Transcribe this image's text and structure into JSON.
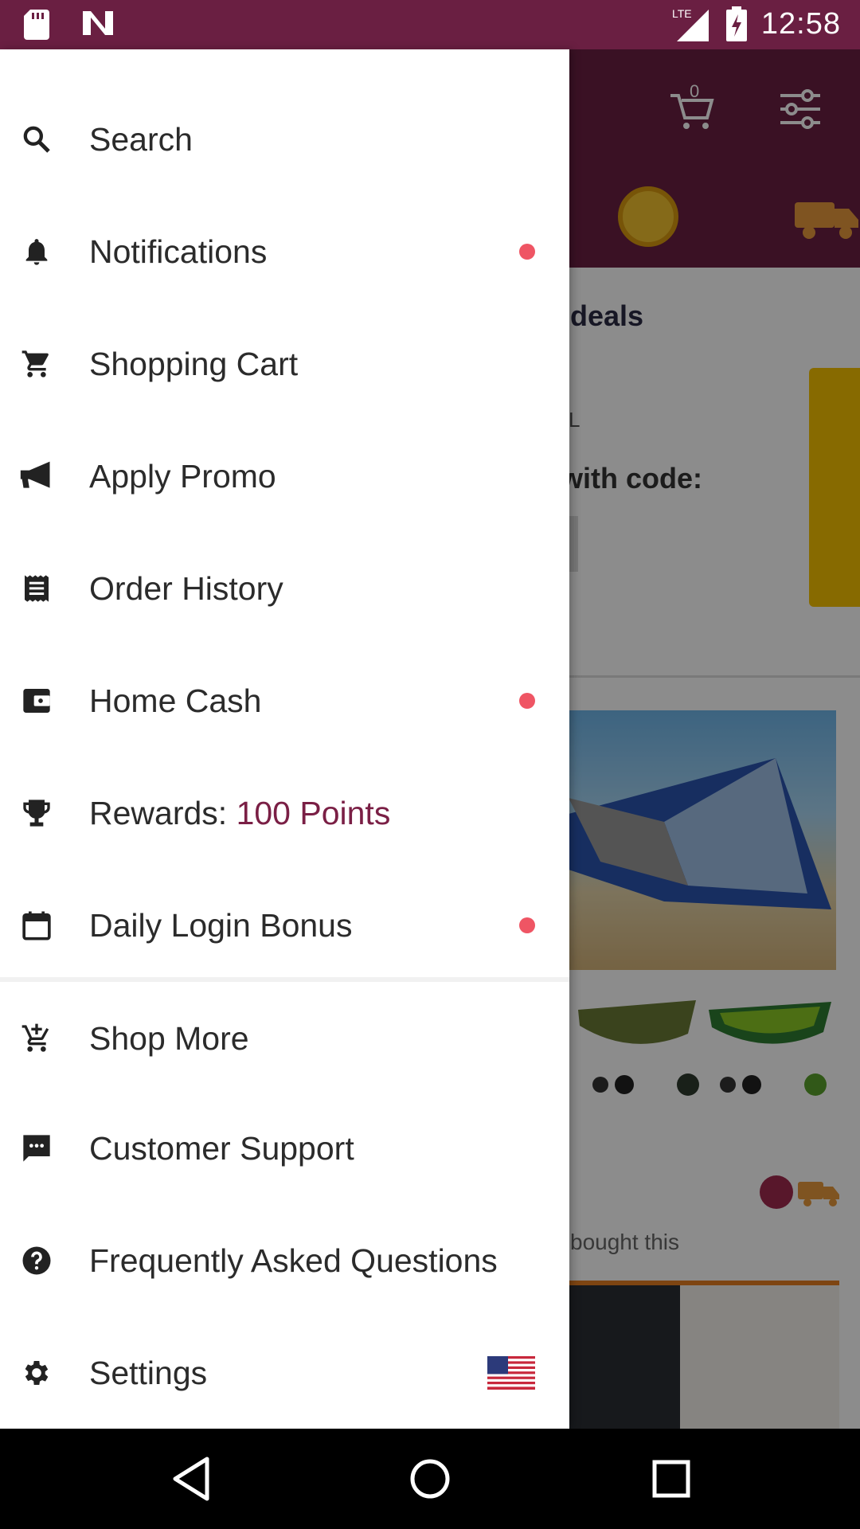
{
  "status_bar": {
    "time": "12:58",
    "network": "LTE",
    "icons": [
      "sd-card-icon",
      "n-notification-icon",
      "signal-icon",
      "battery-charging-icon"
    ]
  },
  "background": {
    "cart_count": "0",
    "deals_title": "deals",
    "coupon_fragment": "L",
    "coupon_code_label": "with code:",
    "bought_text": "bought this"
  },
  "drawer": {
    "items": [
      {
        "label": "Search",
        "icon": "search-icon",
        "dot": false
      },
      {
        "label": "Notifications",
        "icon": "bell-icon",
        "dot": true
      },
      {
        "label": "Shopping Cart",
        "icon": "cart-icon",
        "dot": false
      },
      {
        "label": "Apply Promo",
        "icon": "megaphone-icon",
        "dot": false
      },
      {
        "label": "Order History",
        "icon": "receipt-icon",
        "dot": false
      },
      {
        "label": "Home Cash",
        "icon": "wallet-icon",
        "dot": true
      },
      {
        "label": "Rewards:",
        "value": "100 Points",
        "icon": "trophy-icon",
        "dot": false
      },
      {
        "label": "Daily Login Bonus",
        "icon": "calendar-icon",
        "dot": true
      },
      {
        "label": "Shop More",
        "icon": "add-cart-icon",
        "dot": false
      },
      {
        "label": "Customer Support",
        "icon": "chat-icon",
        "dot": false
      },
      {
        "label": "Frequently Asked Questions",
        "icon": "help-icon",
        "dot": false
      },
      {
        "label": "Settings",
        "icon": "gear-icon",
        "dot": false,
        "flag": "us-flag-icon"
      }
    ]
  },
  "colors": {
    "brand": "#6a1f42",
    "points": "#7a1f45",
    "notification_dot": "#ef5564"
  },
  "nav_bar": {
    "icons": [
      "back-icon",
      "home-icon",
      "recents-icon"
    ]
  }
}
